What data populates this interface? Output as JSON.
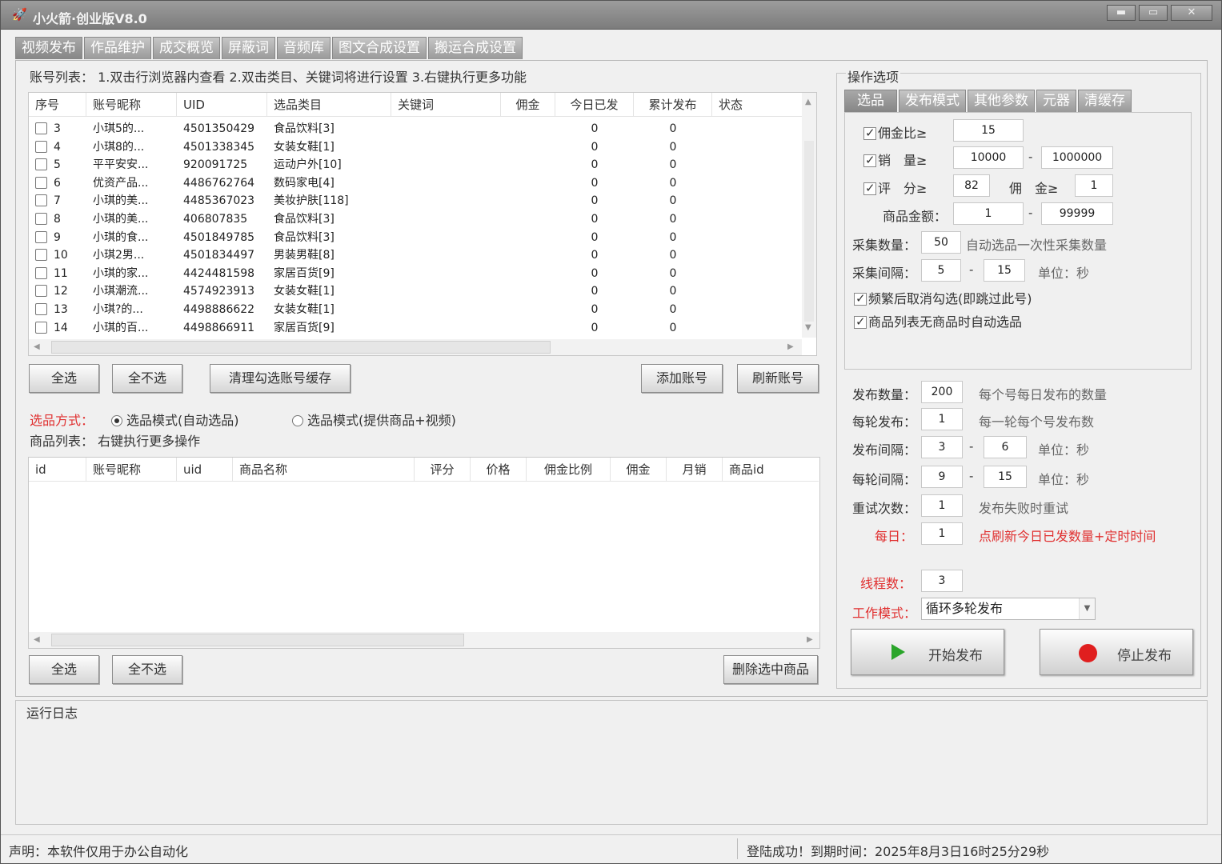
{
  "window": {
    "title": "小火箭·创业版V8.0",
    "min": "▬",
    "max": "▭",
    "close": "✕"
  },
  "main_tabs": [
    "视频发布",
    "作品维护",
    "成交概览",
    "屏蔽词",
    "音频库",
    "图文合成设置",
    "搬运合成设置"
  ],
  "accounts": {
    "hint": "账号列表：  1.双击行浏览器内查看   2.双击类目、关键词将进行设置   3.右键执行更多功能",
    "headers": [
      "序号",
      "账号昵称",
      "UID",
      "选品类目",
      "关键词",
      "佣金",
      "今日已发",
      "累计发布",
      "状态"
    ],
    "rows": [
      {
        "no": "3",
        "name": "小琪5的...",
        "uid": "4501350429",
        "cat": "食品饮料[3]",
        "kw": "",
        "comm": "",
        "today": "0",
        "total": "0",
        "status": ""
      },
      {
        "no": "4",
        "name": "小琪8的...",
        "uid": "4501338345",
        "cat": "女装女鞋[1]",
        "kw": "",
        "comm": "",
        "today": "0",
        "total": "0",
        "status": ""
      },
      {
        "no": "5",
        "name": "平平安安...",
        "uid": "920091725",
        "cat": "运动户外[10]",
        "kw": "",
        "comm": "",
        "today": "0",
        "total": "0",
        "status": ""
      },
      {
        "no": "6",
        "name": "优资产品...",
        "uid": "4486762764",
        "cat": "数码家电[4]",
        "kw": "",
        "comm": "",
        "today": "0",
        "total": "0",
        "status": ""
      },
      {
        "no": "7",
        "name": "小琪的美...",
        "uid": "4485367023",
        "cat": "美妆护肤[118]",
        "kw": "",
        "comm": "",
        "today": "0",
        "total": "0",
        "status": ""
      },
      {
        "no": "8",
        "name": "小琪的美...",
        "uid": "406807835",
        "cat": "食品饮料[3]",
        "kw": "",
        "comm": "",
        "today": "0",
        "total": "0",
        "status": ""
      },
      {
        "no": "9",
        "name": "小琪的食...",
        "uid": "4501849785",
        "cat": "食品饮料[3]",
        "kw": "",
        "comm": "",
        "today": "0",
        "total": "0",
        "status": ""
      },
      {
        "no": "10",
        "name": "小琪2男...",
        "uid": "4501834497",
        "cat": "男装男鞋[8]",
        "kw": "",
        "comm": "",
        "today": "0",
        "total": "0",
        "status": ""
      },
      {
        "no": "11",
        "name": "小琪的家...",
        "uid": "4424481598",
        "cat": "家居百货[9]",
        "kw": "",
        "comm": "",
        "today": "0",
        "total": "0",
        "status": ""
      },
      {
        "no": "12",
        "name": "小琪潮流...",
        "uid": "4574923913",
        "cat": "女装女鞋[1]",
        "kw": "",
        "comm": "",
        "today": "0",
        "total": "0",
        "status": ""
      },
      {
        "no": "13",
        "name": "小琪?的...",
        "uid": "4498886622",
        "cat": "女装女鞋[1]",
        "kw": "",
        "comm": "",
        "today": "0",
        "total": "0",
        "status": ""
      },
      {
        "no": "14",
        "name": "小琪的百...",
        "uid": "4498866911",
        "cat": "家居百货[9]",
        "kw": "",
        "comm": "",
        "today": "0",
        "total": "0",
        "status": ""
      }
    ],
    "btn_select_all": "全选",
    "btn_select_none": "全不选",
    "btn_clear_cache": "清理勾选账号缓存",
    "btn_add": "添加账号",
    "btn_refresh": "刷新账号"
  },
  "selection": {
    "label": "选品方式：",
    "mode1": "选品模式(自动选品)",
    "mode2": "选品模式(提供商品+视频)",
    "products_hint": "商品列表：  右键执行更多操作"
  },
  "products": {
    "headers": [
      "id",
      "账号昵称",
      "uid",
      "商品名称",
      "评分",
      "价格",
      "佣金比例",
      "佣金",
      "月销",
      "商品id"
    ],
    "btn_select_all": "全选",
    "btn_select_none": "全不选",
    "btn_delete": "删除选中商品"
  },
  "options": {
    "title": "操作选项",
    "tabs": [
      "选品",
      "发布模式",
      "其他参数",
      "元器",
      "清缓存"
    ],
    "comm_ratio_label": "佣金比≥",
    "comm_ratio": "15",
    "sales_label": "销　量≥",
    "sales_min": "10000",
    "sales_max": "1000000",
    "rating_label": "评　分≥",
    "rating": "82",
    "commission_label": "佣　金≥",
    "commission": "1",
    "price_label": "商品金额：",
    "price_min": "1",
    "price_max": "99999",
    "collect_count_label": "采集数量：",
    "collect_count": "50",
    "collect_count_hint": "自动选品一次性采集数量",
    "collect_interval_label": "采集间隔：",
    "collect_interval_min": "5",
    "collect_interval_max": "15",
    "unit_sec": "单位：秒",
    "dash": "-",
    "opt_freq": "频繁后取消勾选(即跳过此号)",
    "opt_auto": "商品列表无商品时自动选品"
  },
  "publish": {
    "count_label": "发布数量：",
    "count": "200",
    "count_hint": "每个号每日发布的数量",
    "per_round_label": "每轮发布：",
    "per_round": "1",
    "per_round_hint": "每一轮每个号发布数",
    "interval_label": "发布间隔：",
    "interval_min": "3",
    "interval_max": "6",
    "round_interval_label": "每轮间隔：",
    "round_interval_min": "9",
    "round_interval_max": "15",
    "unit_sec": "单位：秒",
    "retry_label": "重试次数：",
    "retry": "1",
    "retry_hint": "发布失败时重试",
    "daily_label": "每日：",
    "daily": "1",
    "daily_hint": "点刷新今日已发数量+定时时间",
    "threads_label": "线程数：",
    "threads": "3",
    "mode_label": "工作模式：",
    "mode": "循环多轮发布",
    "start": "开始发布",
    "stop": "停止发布"
  },
  "log": {
    "title": "运行日志"
  },
  "status": {
    "left": "声明：本软件仅用于办公自动化",
    "right": "登陆成功！到期时间：2025年8月3日16时25分29秒"
  },
  "colors": {
    "accent_red": "#e03030",
    "play_green": "#2aa52a",
    "stop_red": "#e01f1f"
  }
}
